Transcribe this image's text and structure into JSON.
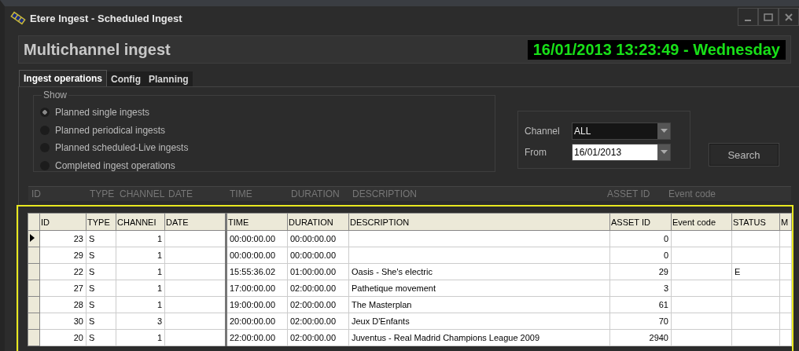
{
  "window": {
    "title": "Etere Ingest - Scheduled Ingest"
  },
  "header": {
    "title": "Multichannel ingest",
    "clock": "16/01/2013 13:23:49 - Wednesday"
  },
  "tabs": [
    {
      "label": "Ingest operations",
      "selected": true
    },
    {
      "label": "Config",
      "selected": false
    },
    {
      "label": "Planning",
      "selected": false
    }
  ],
  "show_group": {
    "title": "Show",
    "options": [
      {
        "label": "Planned single ingests",
        "selected": true
      },
      {
        "label": "Planned periodical ingests",
        "selected": false
      },
      {
        "label": "Planned scheduled-Live ingests",
        "selected": false
      },
      {
        "label": "Completed ingest operations",
        "selected": false
      }
    ]
  },
  "filter": {
    "channel_label": "Channel",
    "channel_value": "ALL",
    "from_label": "From",
    "from_value": "16/01/2013",
    "search": "Search"
  },
  "back_header": [
    "ID",
    "TYPE",
    "CHANNEL",
    "DATE",
    "TIME",
    "DURATION",
    "DESCRIPTION",
    "ASSET ID",
    "Event code"
  ],
  "table": {
    "columns": [
      "ID",
      "TYPE",
      "CHANNEI",
      "DATE",
      "TIME",
      "DURATION",
      "DESCRIPTION",
      "ASSET ID",
      "Event code",
      "STATUS",
      "M"
    ],
    "rows": [
      {
        "selected": true,
        "cells": [
          "23",
          "S",
          "1",
          "",
          "00:00:00.00",
          "00:00:00.00",
          "",
          "0",
          "",
          "",
          ""
        ]
      },
      {
        "selected": false,
        "cells": [
          "29",
          "S",
          "1",
          "",
          "00:00:00.00",
          "00:00:00.00",
          "",
          "0",
          "",
          "",
          ""
        ]
      },
      {
        "selected": false,
        "cells": [
          "22",
          "S",
          "1",
          "",
          "15:55:36.02",
          "01:00:00.00",
          "Oasis - She's electric",
          "29",
          "",
          "E",
          ""
        ]
      },
      {
        "selected": false,
        "cells": [
          "27",
          "S",
          "1",
          "",
          "17:00:00.00",
          "02:00:00.00",
          "Pathetique movement",
          "3",
          "",
          "",
          ""
        ]
      },
      {
        "selected": false,
        "cells": [
          "28",
          "S",
          "1",
          "",
          "19:00:00.00",
          "02:00:00.00",
          "The Masterplan",
          "61",
          "",
          "",
          ""
        ]
      },
      {
        "selected": false,
        "cells": [
          "30",
          "S",
          "3",
          "",
          "20:00:00.00",
          "02:00:00.00",
          "Jeux D'Enfants",
          "70",
          "",
          "",
          ""
        ]
      },
      {
        "selected": false,
        "cells": [
          "20",
          "S",
          "1",
          "",
          "22:00:00.00",
          "02:00:00.00",
          "Juventus - Real Madrid Champions League 2009",
          "2940",
          "",
          "",
          ""
        ]
      }
    ]
  }
}
